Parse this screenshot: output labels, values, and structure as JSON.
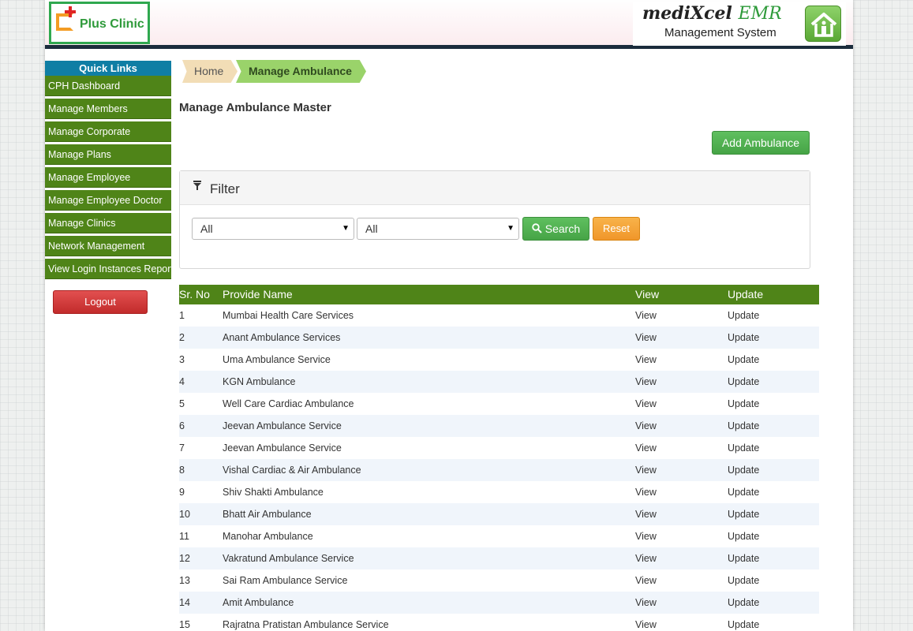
{
  "header": {
    "logo_text": "Plus Clinic",
    "brand_title": "mediXcel",
    "brand_emr": "EMR",
    "brand_subtitle": "Management System"
  },
  "sidebar": {
    "title": "Quick Links",
    "items": [
      "CPH Dashboard",
      "Manage Members",
      "Manage Corporate",
      "Manage Plans",
      "Manage Employee",
      "Manage Employee Doctor",
      "Manage Clinics",
      "Network Management",
      "View Login Instances Report"
    ],
    "logout_label": "Logout"
  },
  "breadcrumb": {
    "home": "Home",
    "current": "Manage Ambulance"
  },
  "page_title": "Manage Ambulance Master",
  "add_button_label": "Add Ambulance",
  "filter": {
    "label": "Filter",
    "select1_value": "All",
    "select2_value": "All",
    "search_label": "Search",
    "reset_label": "Reset"
  },
  "table": {
    "headers": [
      "Sr. No",
      "Provide Name",
      "View",
      "Update"
    ],
    "rows": [
      [
        "1",
        "Mumbai Health Care Services",
        "View",
        "Update"
      ],
      [
        "2",
        "Anant Ambulance Services",
        "View",
        "Update"
      ],
      [
        "3",
        "Uma Ambulance Service",
        "View",
        "Update"
      ],
      [
        "4",
        "KGN Ambulance",
        "View",
        "Update"
      ],
      [
        "5",
        "Well Care Cardiac Ambulance",
        "View",
        "Update"
      ],
      [
        "6",
        "Jeevan Ambulance Service",
        "View",
        "Update"
      ],
      [
        "7",
        "Jeevan Ambulance Service",
        "View",
        "Update"
      ],
      [
        "8",
        "Vishal Cardiac & Air Ambulance",
        "View",
        "Update"
      ],
      [
        "9",
        "Shiv Shakti Ambulance",
        "View",
        "Update"
      ],
      [
        "10",
        "Bhatt Air Ambulance",
        "View",
        "Update"
      ],
      [
        "11",
        "Manohar Ambulance",
        "View",
        "Update"
      ],
      [
        "12",
        "Vakratund Ambulance Service",
        "View",
        "Update"
      ],
      [
        "13",
        "Sai Ram Ambulance Service",
        "View",
        "Update"
      ],
      [
        "14",
        "Amit Ambulance",
        "View",
        "Update"
      ],
      [
        "15",
        "Rajratna Pratistan Ambulance Service",
        "View",
        "Update"
      ]
    ]
  },
  "colors": {
    "menu_green": "#4f8418",
    "quick_links_blue": "#0f7ea4",
    "button_green": "#46a446",
    "reset_orange": "#f0962a",
    "logout_red": "#c22b2b"
  }
}
